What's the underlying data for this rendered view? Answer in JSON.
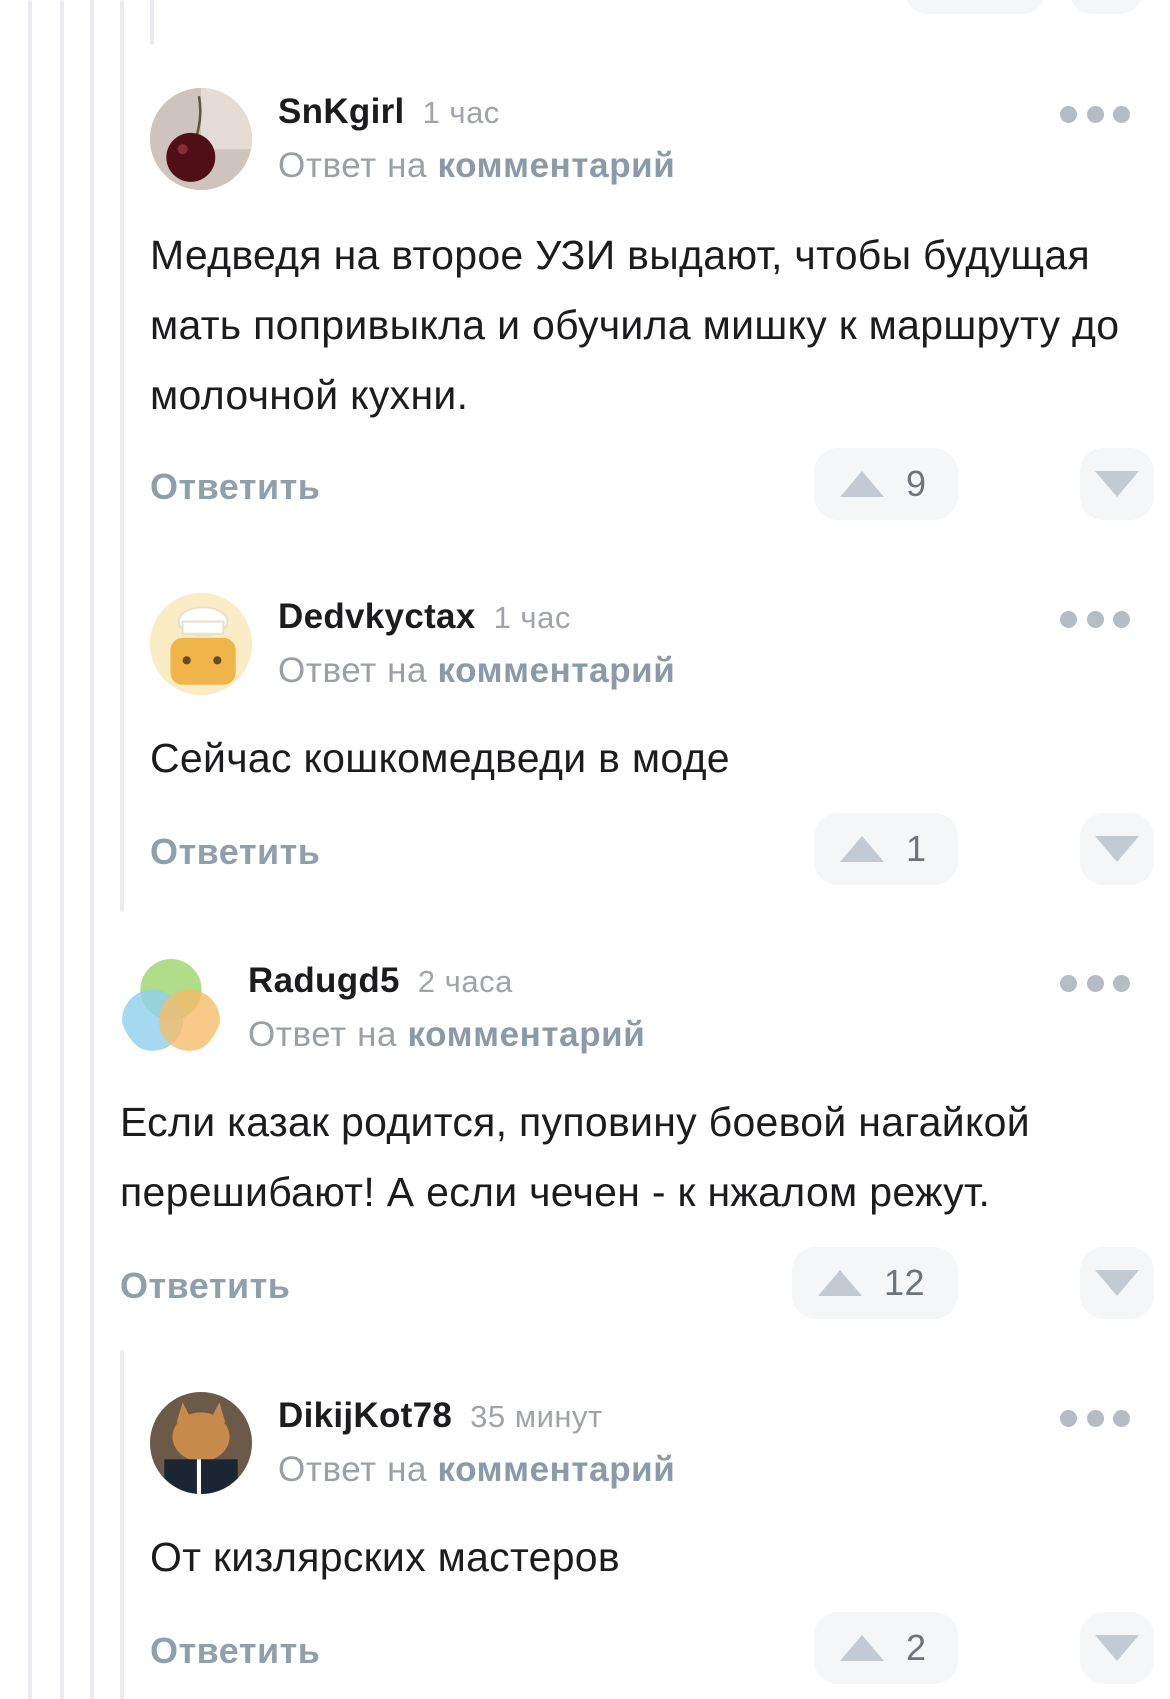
{
  "comments": [
    {
      "username": "SnKgirl",
      "time": "1 час",
      "reply_prefix": "Ответ на",
      "reply_link": "комментарий",
      "text": "Медведя на второе УЗИ выдают, чтобы будущая мать попривыкла и обучила мишку к маршруту до молочной кухни.",
      "reply_label": "Ответить",
      "score": "9"
    },
    {
      "username": "Dedvkyctax",
      "time": "1 час",
      "reply_prefix": "Ответ на",
      "reply_link": "комментарий",
      "text": "Сейчас кошкомедведи в моде",
      "reply_label": "Ответить",
      "score": "1"
    },
    {
      "username": "Radugd5",
      "time": "2 часа",
      "reply_prefix": "Ответ на",
      "reply_link": "комментарий",
      "text": "Если казак родится, пуповину боевой нагайкой перешибают! А если чечен - к нжалом режут.",
      "reply_label": "Ответить",
      "score": "12"
    },
    {
      "username": "DikijKot78",
      "time": "35 минут",
      "reply_prefix": "Ответ на",
      "reply_link": "комментарий",
      "text": "От кизлярских мастеров",
      "reply_label": "Ответить",
      "score": "2"
    }
  ],
  "colors": {
    "accent_link": "#8a9aa8",
    "muted": "#a0a4aa",
    "pill_bg": "#f5f6f8",
    "thread_line": "#e9ebee"
  }
}
